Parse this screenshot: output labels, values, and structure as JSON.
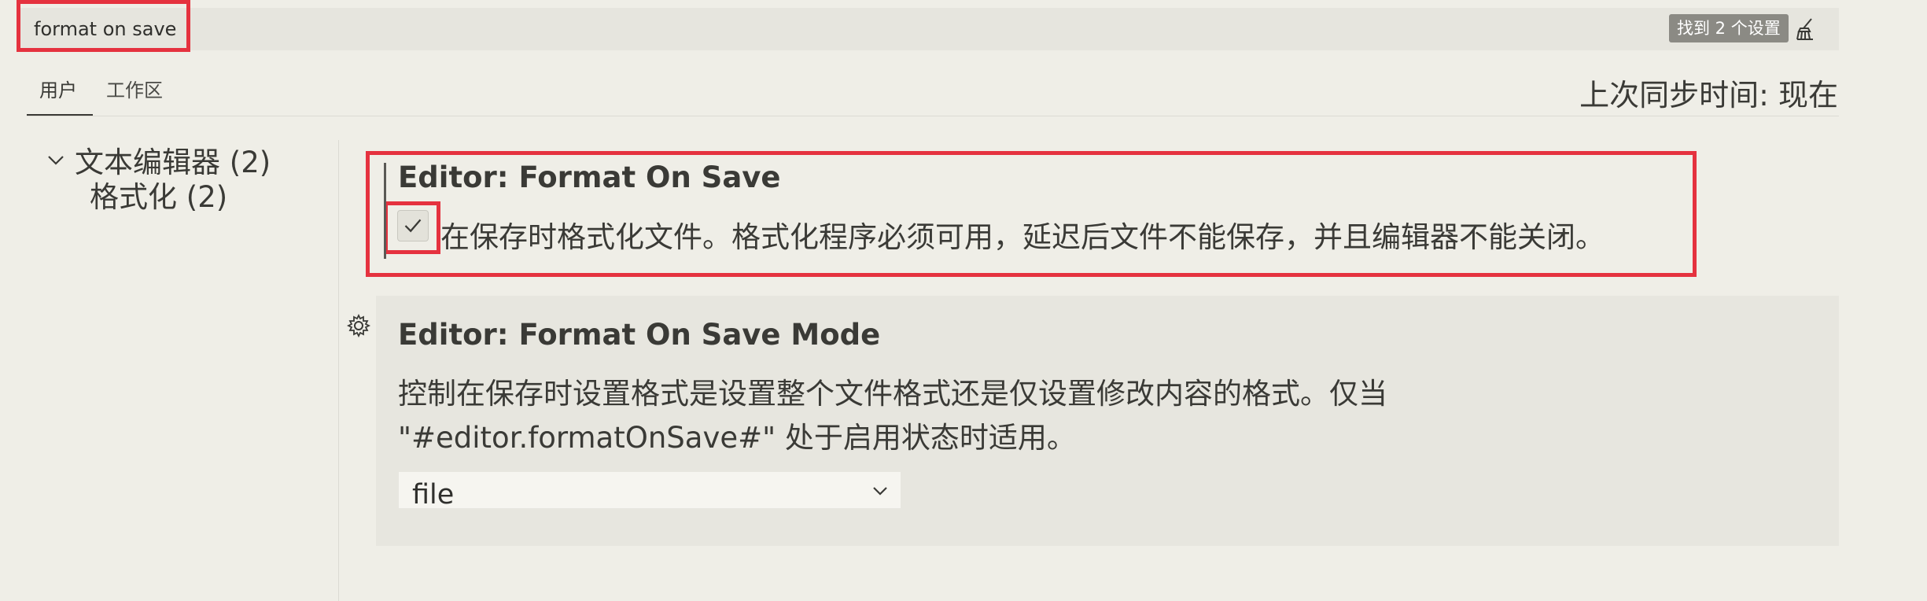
{
  "search": {
    "value": "format on save",
    "result_count": "找到 2 个设置"
  },
  "tabs": [
    {
      "label": "用户"
    },
    {
      "label": "工作区"
    }
  ],
  "sync": {
    "label": "上次同步时间: 现在"
  },
  "toc": {
    "group": "文本编辑器 (2)",
    "subgroup": "格式化 (2)"
  },
  "settings": [
    {
      "title": "Editor: Format On Save",
      "description": "在保存时格式化文件。格式化程序必须可用，延迟后文件不能保存，并且编辑器不能关闭。",
      "checked": true
    },
    {
      "title": "Editor: Format On Save Mode",
      "description_line1": "控制在保存时设置格式是设置整个文件格式还是仅设置修改内容的格式。仅当",
      "description_line2": "\"#editor.formatOnSave#\" 处于启用状态时适用。",
      "value": "file"
    }
  ],
  "icons": {
    "clear": "clear-filter-icon",
    "gear": "gear-icon",
    "checkmark": "checkmark-icon",
    "chevron": "chevron-down-icon"
  },
  "colors": {
    "background": "#efeee7",
    "highlight": "#e5323f",
    "badge": "#8b8a84"
  }
}
